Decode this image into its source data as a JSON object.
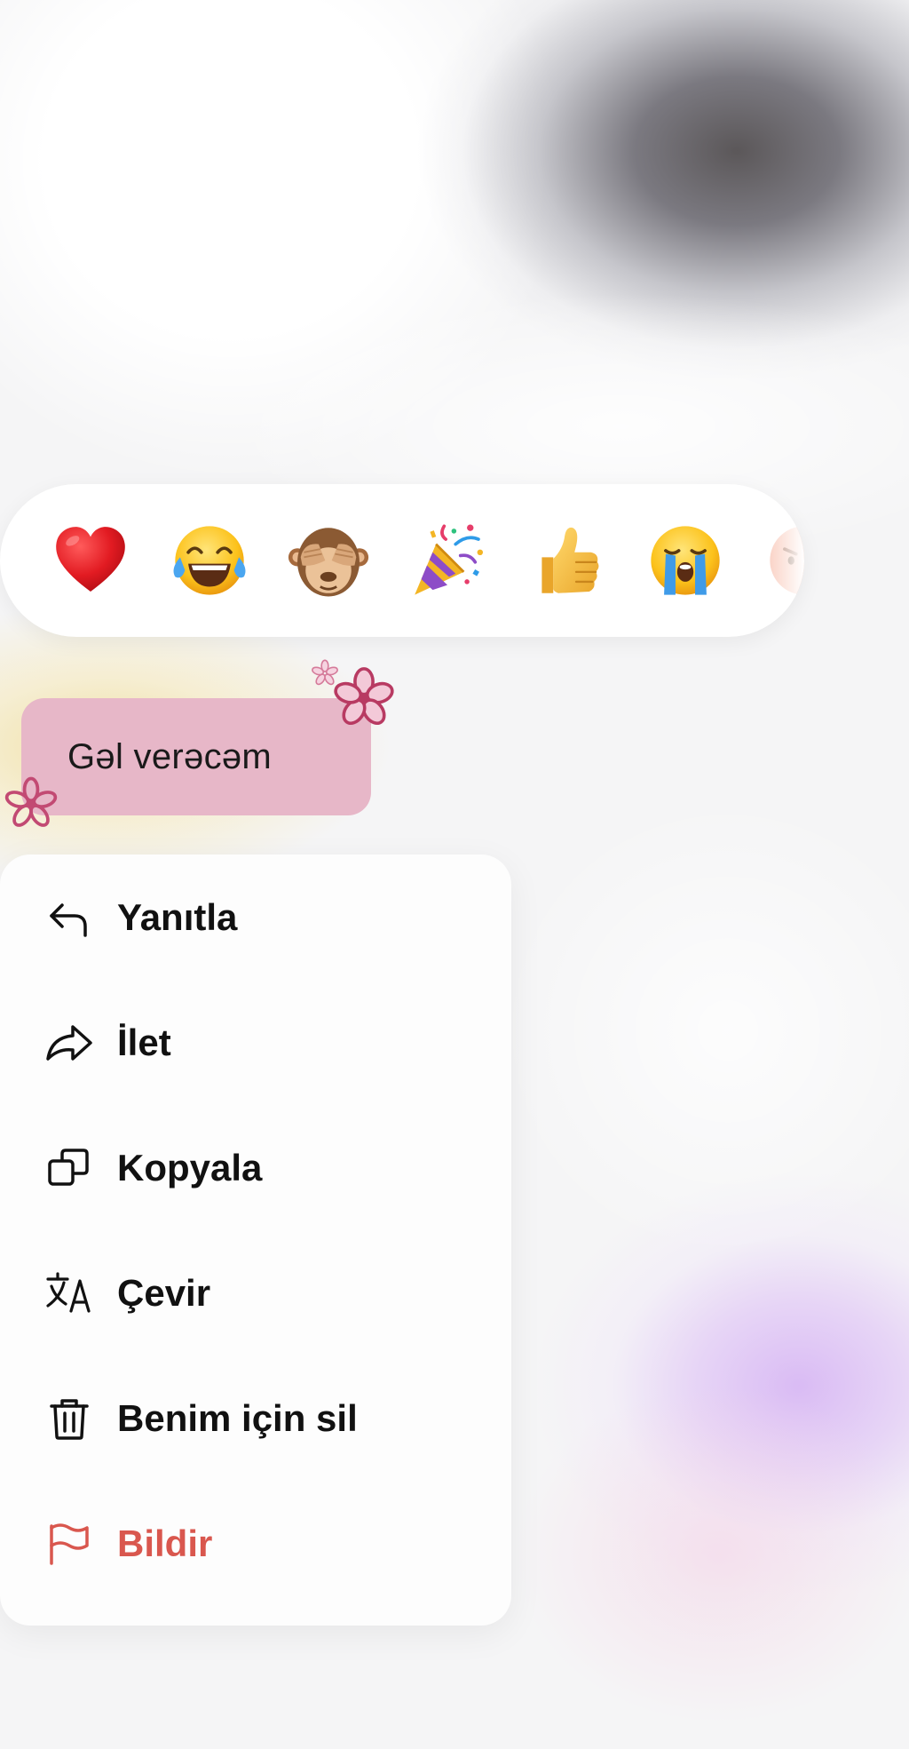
{
  "message": {
    "text": "Gəl verəcəm",
    "bubble_color": "#e7b7c8"
  },
  "reactions": [
    {
      "name": "red-heart",
      "emoji": "❤️"
    },
    {
      "name": "face-with-tears-of-joy",
      "emoji": "😂"
    },
    {
      "name": "see-no-evil-monkey",
      "emoji": "🙈"
    },
    {
      "name": "party-popper",
      "emoji": "🎉"
    },
    {
      "name": "thumbs-up",
      "emoji": "👍"
    },
    {
      "name": "loudly-crying-face",
      "emoji": "😭"
    },
    {
      "name": "angry-face-partial",
      "emoji": "😡"
    }
  ],
  "menu": {
    "items": [
      {
        "label": "Yanıtla",
        "icon": "reply-icon"
      },
      {
        "label": "İlet",
        "icon": "forward-icon"
      },
      {
        "label": "Kopyala",
        "icon": "copy-icon"
      },
      {
        "label": "Çevir",
        "icon": "translate-icon"
      },
      {
        "label": "Benim için sil",
        "icon": "trash-icon"
      },
      {
        "label": "Bildir",
        "icon": "flag-icon",
        "color": "#d9574e"
      }
    ]
  },
  "colors": {
    "danger": "#d9574e",
    "text": "#111111"
  }
}
